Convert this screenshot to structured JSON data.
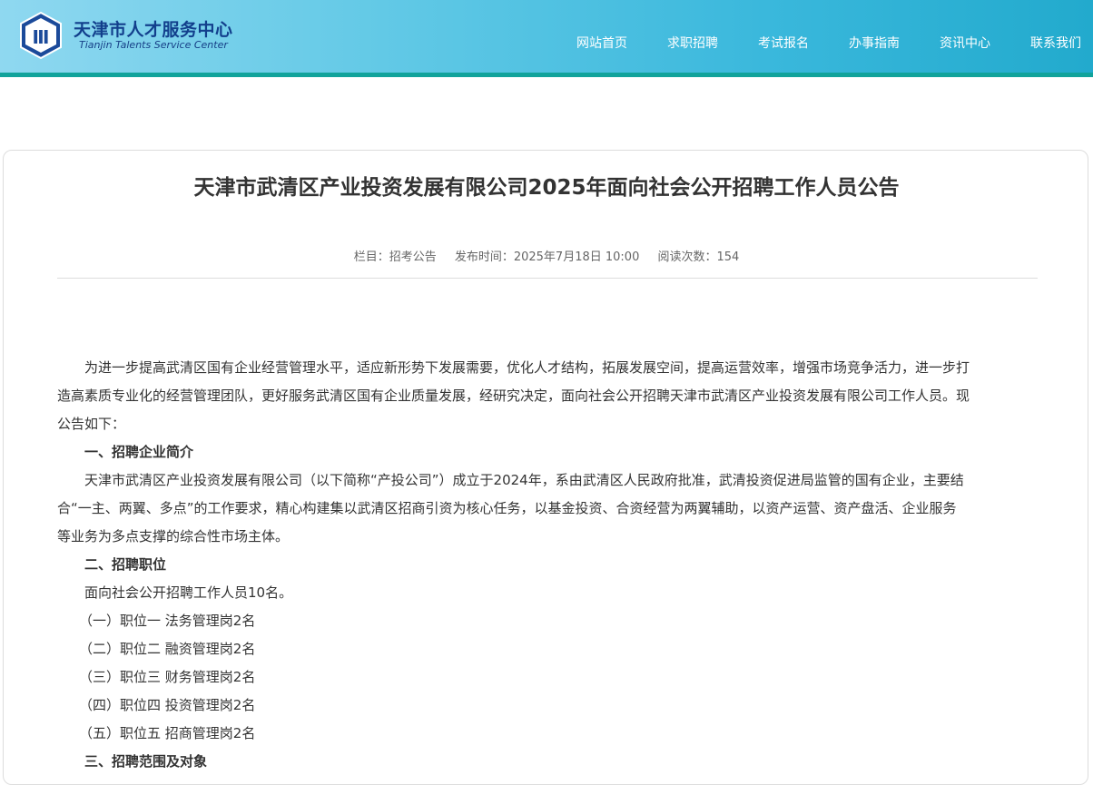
{
  "header": {
    "logo_cn": "天津市人才服务中心",
    "logo_en": "Tianjin Talents Service Center",
    "nav": [
      "网站首页",
      "求职招聘",
      "考试报名",
      "办事指南",
      "资讯中心",
      "联系我们"
    ]
  },
  "article": {
    "title": "天津市武清区产业投资发展有限公司2025年面向社会公开招聘工作人员公告",
    "meta": {
      "column": "栏目：招考公告",
      "publish": "发布时间：2025年7月18日 10:00",
      "views": "阅读次数：154"
    },
    "intro_lines": [
      "为进一步提高武清区国有企业经营管理水平，适应新形势下发展需要，优化人才结构，拓展发展空间，提高运营效率，增强市场竞争活力，进一步打",
      "造高素质专业化的经营管理团队，更好服务武清区国有企业质量发展，经研究决定，面向社会公开招聘天津市武清区产业投资发展有限公司工作人员。现",
      "公告如下："
    ],
    "section1": "一、招聘企业简介",
    "company_lines": [
      "天津市武清区产业投资发展有限公司（以下简称“产投公司”）成立于2024年，系由武清区人民政府批准，武清投资促进局监管的国有企业，主要结",
      "合“一主、两翼、多点”的工作要求，精心构建集以武清区招商引资为核心任务，以基金投资、合资经营为两翼辅助，以资产运营、资产盘活、企业服务",
      "等业务为多点支撑的综合性市场主体。"
    ],
    "section2": "二、招聘职位",
    "recruit_total": "面向社会公开招聘工作人员10名。",
    "positions": [
      "（一）职位一  法务管理岗2名",
      "（二）职位二  融资管理岗2名",
      "（三）职位三  财务管理岗2名",
      "（四）职位四  投资管理岗2名",
      "（五）职位五  招商管理岗2名"
    ],
    "section3": "三、招聘范围及对象"
  },
  "colors": {
    "header_gradient_start": "#8fd8f0",
    "header_gradient_end": "#22aacd",
    "header_line": "#11a39b",
    "logo_text": "#123f8c"
  }
}
